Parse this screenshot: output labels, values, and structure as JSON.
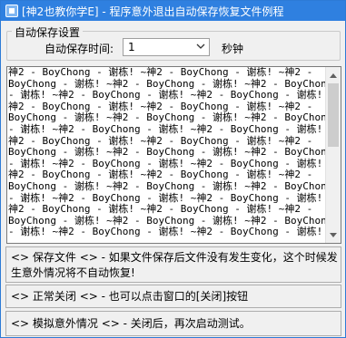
{
  "window": {
    "title": "[神2也教你学E] - 程序意外退出自动保存恢复文件例程"
  },
  "autosave_group": {
    "legend": "自动保存设置",
    "time_label": "自动保存时间:",
    "time_value": "1",
    "unit_label": "秒钟"
  },
  "textbox": {
    "content": "神2 - BoyChong - 谢栋! ~神2 - BoyChong - 谢栋! ~神2 -\nBoyChong - 谢栋! ~神2 - BoyChong - 谢栋! ~神2 - BoyChong\n- 谢栋! ~神2 - BoyChong - 谢栋! ~神2 - BoyChong - 谢栋! ~\n神2 - BoyChong - 谢栋! ~神2 - BoyChong - 谢栋! ~神2 -\nBoyChong - 谢栋! ~神2 - BoyChong - 谢栋! ~神2 - BoyChong\n- 谢栋! ~神2 - BoyChong - 谢栋! ~神2 - BoyChong - 谢栋! ~\n神2 - BoyChong - 谢栋! ~神2 - BoyChong - 谢栋! ~神2 -\nBoyChong - 谢栋! ~神2 - BoyChong - 谢栋! ~神2 - BoyChong\n- 谢栋! ~神2 - BoyChong - 谢栋! ~神2 - BoyChong - 谢栋! ~\n神2 - BoyChong - 谢栋! ~神2 - BoyChong - 谢栋! ~神2 -\nBoyChong - 谢栋! ~神2 - BoyChong - 谢栋! ~神2 - BoyChong\n- 谢栋! ~神2 - BoyChong - 谢栋! ~神2 - BoyChong - 谢栋! ~\n神2 - BoyChong - 谢栋! ~神2 - BoyChong - 谢栋! ~神2 -\nBoyChong - 谢栋! ~神2 - BoyChong - 谢栋! ~神2 - BoyChong\n- 谢栋! ~神2 - BoyChong - 谢栋! ~神2 - BoyChong - 谢栋! ~"
  },
  "buttons": {
    "save": "<>  保存文件  <> - 如果文件保存后文件没有发生变化，这个时候发生意外情况将不自动恢复!",
    "normal_close": "<>  正常关闭  <> - 也可以点击窗口的[关闭]按钮",
    "simulate_crash": "<>  模拟意外情况  <> - 关闭后，再次启动测试。"
  },
  "icons": {
    "app": "app-icon",
    "dropdown": "chevron-down-icon",
    "scroll_up": "arrow-up-icon",
    "scroll_down": "arrow-down-icon"
  },
  "colors": {
    "titlebar": "#2f80e0",
    "window_bg": "#f0f0f0"
  }
}
